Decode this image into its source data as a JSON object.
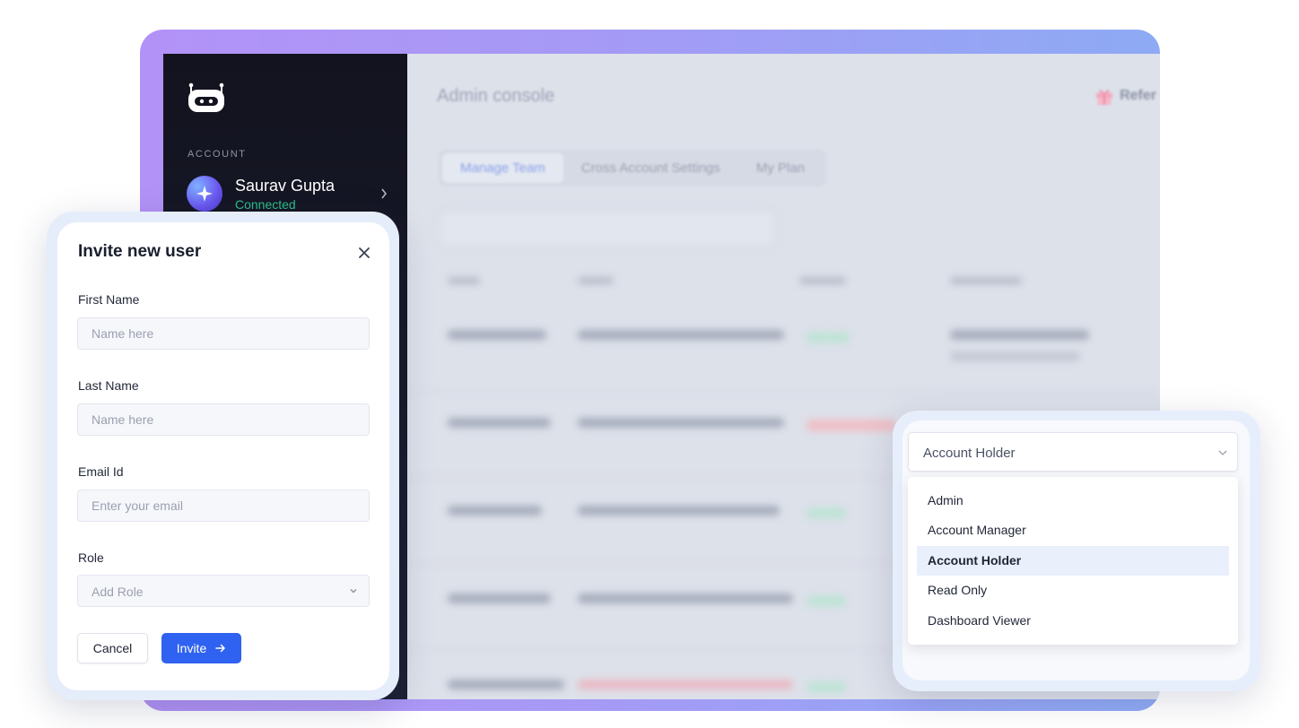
{
  "sidebar": {
    "section_label": "ACCOUNT",
    "account": {
      "name": "Saurav Gupta",
      "status": "Connected"
    },
    "icons": {
      "logo": "robot-logo-icon",
      "avatar": "sparkle-icon",
      "chevron": "chevron-right-icon"
    }
  },
  "main": {
    "title": "Admin console",
    "refer_label": "Refer",
    "tabs": [
      {
        "label": "Manage Team",
        "active": true
      },
      {
        "label": "Cross Account Settings",
        "active": false
      },
      {
        "label": "My Plan",
        "active": false
      }
    ]
  },
  "invite_modal": {
    "title": "Invite new user",
    "fields": {
      "first_name": {
        "label": "First Name",
        "placeholder": "Name here",
        "value": ""
      },
      "last_name": {
        "label": "Last Name",
        "placeholder": "Name here",
        "value": ""
      },
      "email": {
        "label": "Email Id",
        "placeholder": "Enter your email",
        "value": ""
      },
      "role": {
        "label": "Role",
        "placeholder": "Add Role"
      }
    },
    "cancel_label": "Cancel",
    "invite_label": "Invite"
  },
  "role_dropdown": {
    "selected": "Account Holder",
    "options": [
      "Admin",
      "Account Manager",
      "Account Holder",
      "Read Only",
      "Dashboard Viewer"
    ]
  },
  "colors": {
    "accent": "#2f62f0",
    "connected": "#29c28d",
    "sidebar_bg": "#13131f",
    "frame_gradient_start": "#b392f7",
    "frame_gradient_end": "#8eaaf4"
  }
}
